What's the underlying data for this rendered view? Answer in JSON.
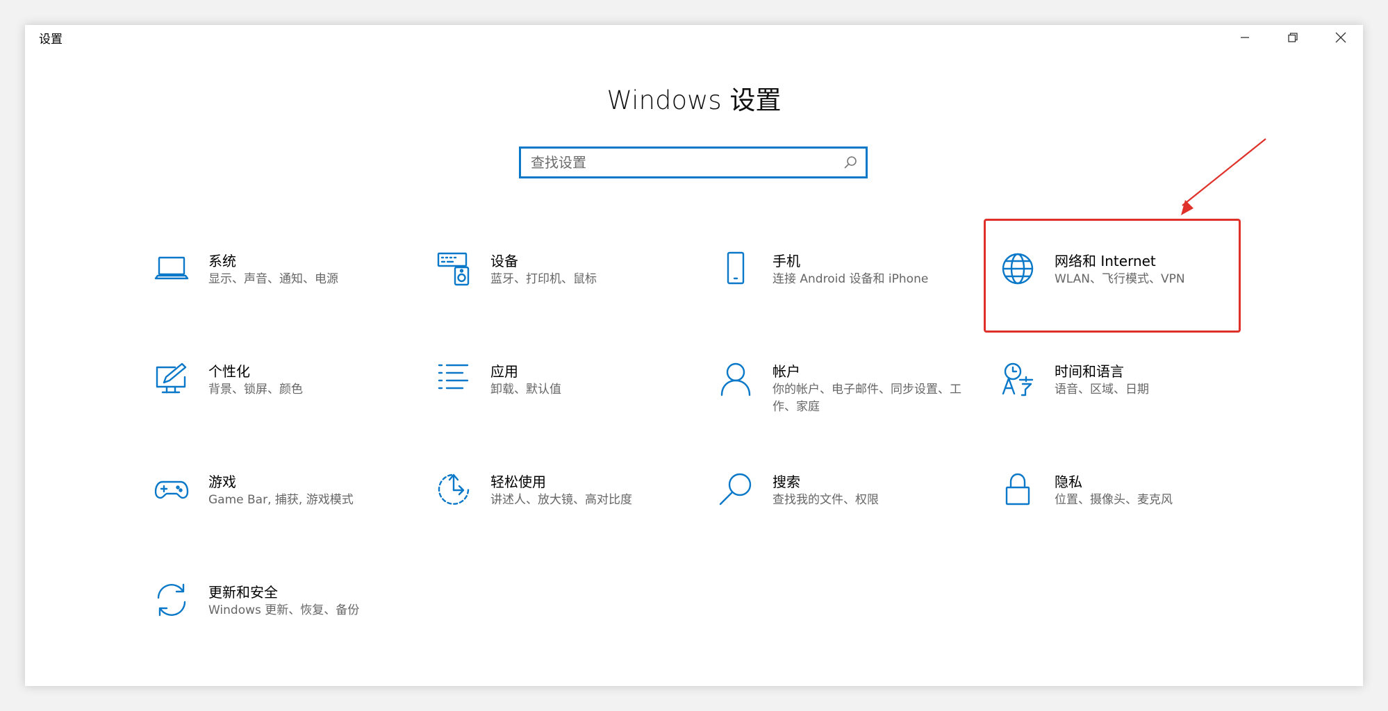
{
  "window": {
    "title": "设置"
  },
  "header": {
    "title": "Windows 设置"
  },
  "search": {
    "placeholder": "查找设置",
    "value": ""
  },
  "colors": {
    "accent": "#0a78c8",
    "highlight": "#e0302a"
  },
  "tiles": [
    {
      "title": "系统",
      "desc": "显示、声音、通知、电源",
      "icon": "laptop-icon"
    },
    {
      "title": "设备",
      "desc": "蓝牙、打印机、鼠标",
      "icon": "devices-icon"
    },
    {
      "title": "手机",
      "desc": "连接 Android 设备和 iPhone",
      "icon": "phone-icon"
    },
    {
      "title": "网络和 Internet",
      "desc": "WLAN、飞行模式、VPN",
      "icon": "globe-icon"
    },
    {
      "title": "个性化",
      "desc": "背景、锁屏、颜色",
      "icon": "personalization-icon"
    },
    {
      "title": "应用",
      "desc": "卸载、默认值",
      "icon": "apps-list-icon"
    },
    {
      "title": "帐户",
      "desc": "你的帐户、电子邮件、同步设置、工作、家庭",
      "icon": "person-icon"
    },
    {
      "title": "时间和语言",
      "desc": "语音、区域、日期",
      "icon": "time-language-icon"
    },
    {
      "title": "游戏",
      "desc": "Game Bar, 捕获, 游戏模式",
      "icon": "gamepad-icon"
    },
    {
      "title": "轻松使用",
      "desc": "讲述人、放大镜、高对比度",
      "icon": "ease-of-access-icon"
    },
    {
      "title": "搜索",
      "desc": "查找我的文件、权限",
      "icon": "search-magnifier-icon"
    },
    {
      "title": "隐私",
      "desc": "位置、摄像头、麦克风",
      "icon": "lock-icon"
    },
    {
      "title": "更新和安全",
      "desc": "Windows 更新、恢复、备份",
      "icon": "sync-icon"
    }
  ]
}
